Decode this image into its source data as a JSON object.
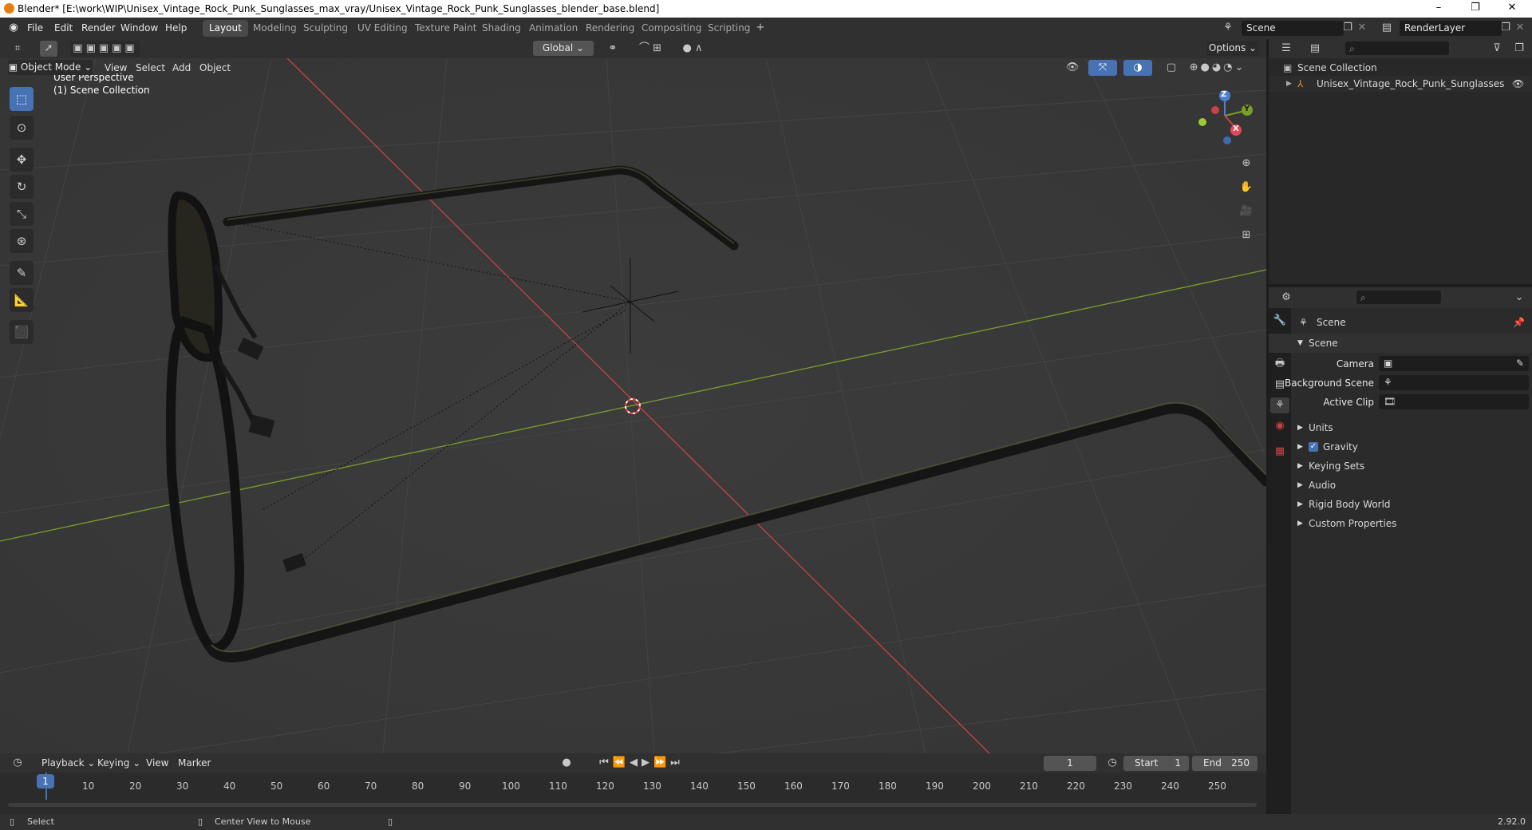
{
  "window": {
    "title": "Blender* [E:\\work\\WIP\\Unisex_Vintage_Rock_Punk_Sunglasses_max_vray/Unisex_Vintage_Rock_Punk_Sunglasses_blender_base.blend]",
    "minimize": "–",
    "maximize": "❐",
    "close": "✕"
  },
  "menu": [
    "File",
    "Edit",
    "Render",
    "Window",
    "Help"
  ],
  "workspace_tabs": [
    "Layout",
    "Modeling",
    "Sculpting",
    "UV Editing",
    "Texture Paint",
    "Shading",
    "Animation",
    "Rendering",
    "Compositing",
    "Scripting"
  ],
  "active_tab": "Layout",
  "scene_field": "Scene",
  "render_layer_field": "RenderLayer",
  "header": {
    "transform_orientation": "Global",
    "options": "Options"
  },
  "viewport_header": {
    "mode": "Object Mode",
    "menus": [
      "View",
      "Select",
      "Add",
      "Object"
    ]
  },
  "viewport": {
    "perspective": "User Perspective",
    "collection": "(1) Scene Collection",
    "gizmo": {
      "z": "Z",
      "y": "Y",
      "x": "X"
    }
  },
  "outliner": {
    "root": "Scene Collection",
    "item": "Unisex_Vintage_Rock_Punk_Sunglasses"
  },
  "properties": {
    "context": "Scene",
    "section": "Scene",
    "fields": [
      {
        "label": "Camera"
      },
      {
        "label": "Background Scene"
      },
      {
        "label": "Active Clip"
      }
    ],
    "panels": [
      "Units",
      "Gravity",
      "Keying Sets",
      "Audio",
      "Rigid Body World",
      "Custom Properties"
    ],
    "gravity_checked": true
  },
  "timeline": {
    "menus": [
      "Playback",
      "Keying",
      "View",
      "Marker"
    ],
    "current_frame": "1",
    "start_label": "Start",
    "start": "1",
    "end_label": "End",
    "end": "250",
    "ticks": [
      "1",
      "10",
      "20",
      "30",
      "40",
      "50",
      "60",
      "70",
      "80",
      "90",
      "100",
      "110",
      "120",
      "130",
      "140",
      "150",
      "160",
      "170",
      "180",
      "190",
      "200",
      "210",
      "220",
      "230",
      "240",
      "250"
    ]
  },
  "statusbar": {
    "left": "Select",
    "middle": "Center View to Mouse",
    "version": "2.92.0"
  },
  "colors": {
    "accent": "#4772b3",
    "x_axis": "#c94245",
    "y_axis": "#7a9e2a"
  }
}
